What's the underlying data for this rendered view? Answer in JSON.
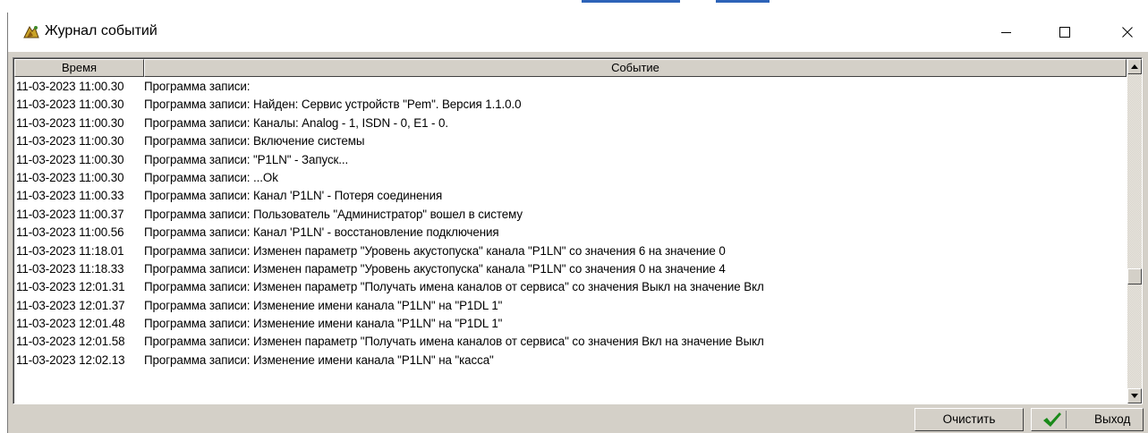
{
  "window": {
    "title": "Журнал событий",
    "controls": {
      "minimize": "minimize-icon",
      "maximize": "maximize-icon",
      "close": "close-icon"
    }
  },
  "table": {
    "columns": [
      "Время",
      "Событие"
    ],
    "rows": [
      {
        "time": "11-03-2023 11:00.30",
        "event": "Программа записи:"
      },
      {
        "time": "11-03-2023 11:00.30",
        "event": "Программа записи: Найден: Сервис устройств \"Pem\". Версия 1.1.0.0"
      },
      {
        "time": "11-03-2023 11:00.30",
        "event": "Программа записи: Каналы: Analog - 1, ISDN - 0, E1 - 0."
      },
      {
        "time": "11-03-2023 11:00.30",
        "event": "Программа записи: Включение системы"
      },
      {
        "time": "11-03-2023 11:00.30",
        "event": "Программа записи: \"P1LN\" - Запуск..."
      },
      {
        "time": "11-03-2023 11:00.30",
        "event": "Программа записи:  ...Ok"
      },
      {
        "time": "11-03-2023 11:00.33",
        "event": "Программа записи: Канал 'P1LN' - Потеря соединения"
      },
      {
        "time": "11-03-2023 11:00.37",
        "event": "Программа записи: Пользователь \"Администратор\" вошел в систему"
      },
      {
        "time": "11-03-2023 11:00.56",
        "event": "Программа записи: Канал 'P1LN' - восстановление подключения"
      },
      {
        "time": "11-03-2023 11:18.01",
        "event": "Программа записи: Изменен параметр \"Уровень акустопуска\" канала \"P1LN\" со значения 6 на значение 0"
      },
      {
        "time": "11-03-2023 11:18.33",
        "event": "Программа записи: Изменен параметр \"Уровень акустопуска\" канала \"P1LN\" со значения 0 на значение 4"
      },
      {
        "time": "11-03-2023 12:01.31",
        "event": "Программа записи: Изменен параметр \"Получать имена каналов от сервиса\" со значения Выкл на значение Вкл"
      },
      {
        "time": "11-03-2023 12:01.37",
        "event": "Программа записи: Изменение имени канала \"P1LN\" на \"P1DL 1\""
      },
      {
        "time": "11-03-2023 12:01.48",
        "event": "Программа записи: Изменение имени канала \"P1LN\" на \"P1DL 1\""
      },
      {
        "time": "11-03-2023 12:01.58",
        "event": "Программа записи: Изменен параметр \"Получать имена каналов от сервиса\" со значения Вкл на значение Выкл"
      },
      {
        "time": "11-03-2023 12:02.13",
        "event": "Программа записи: Изменение имени канала \"P1LN\" на \"касса\""
      }
    ]
  },
  "buttons": {
    "clear": "Очистить",
    "exit": "Выход"
  },
  "colors": {
    "face": "#d4d0c8",
    "title_bg": "#ffffff",
    "check_green": "#1a8a1a"
  }
}
